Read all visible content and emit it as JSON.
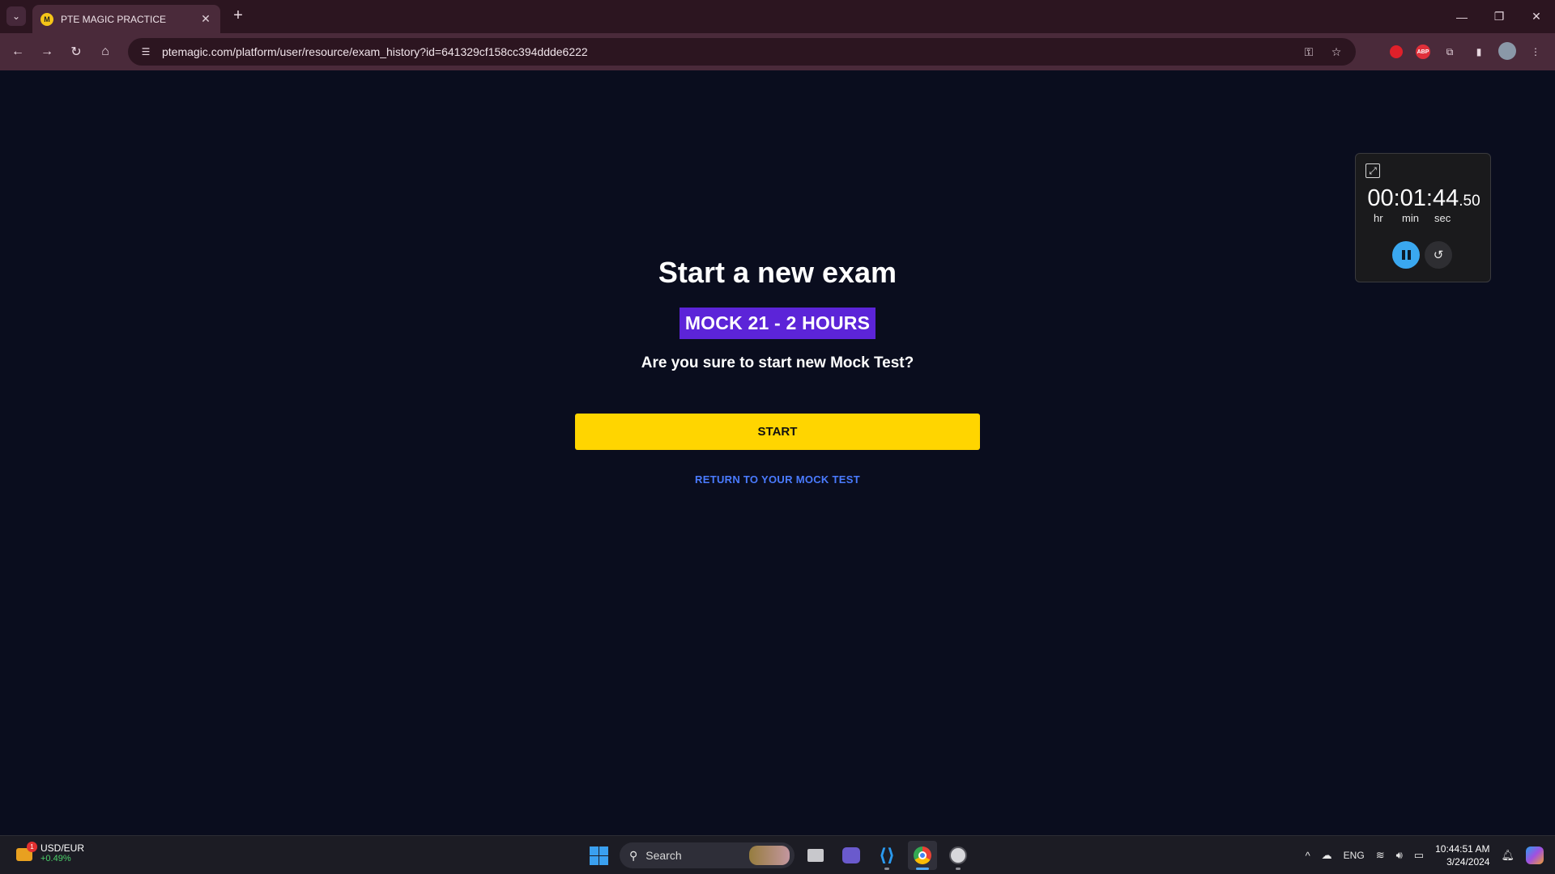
{
  "browser": {
    "tab_title": "PTE MAGIC PRACTICE",
    "url": "ptemagic.com/platform/user/resource/exam_history?id=641329cf158cc394ddde6222"
  },
  "page": {
    "title": "Start a new exam",
    "exam_name": "MOCK 21 - 2 HOURS",
    "question": "Are you sure to start new Mock Test?",
    "start_label": "START",
    "return_label": "RETURN TO YOUR MOCK TEST",
    "accent_color": "#5c24d8",
    "button_color": "#ffd500",
    "link_color": "#4a7bff"
  },
  "stopwatch": {
    "time_main": "00:01:44",
    "time_fraction": ".50",
    "units": {
      "hr": "hr",
      "min": "min",
      "sec": "sec"
    },
    "pause_color": "#3aa8f0"
  },
  "taskbar": {
    "widget_pair": "USD/EUR",
    "widget_change": "+0.49%",
    "widget_badge": "1",
    "search_label": "Search",
    "language": "ENG",
    "time": "10:44:51 AM",
    "date": "3/24/2024"
  }
}
